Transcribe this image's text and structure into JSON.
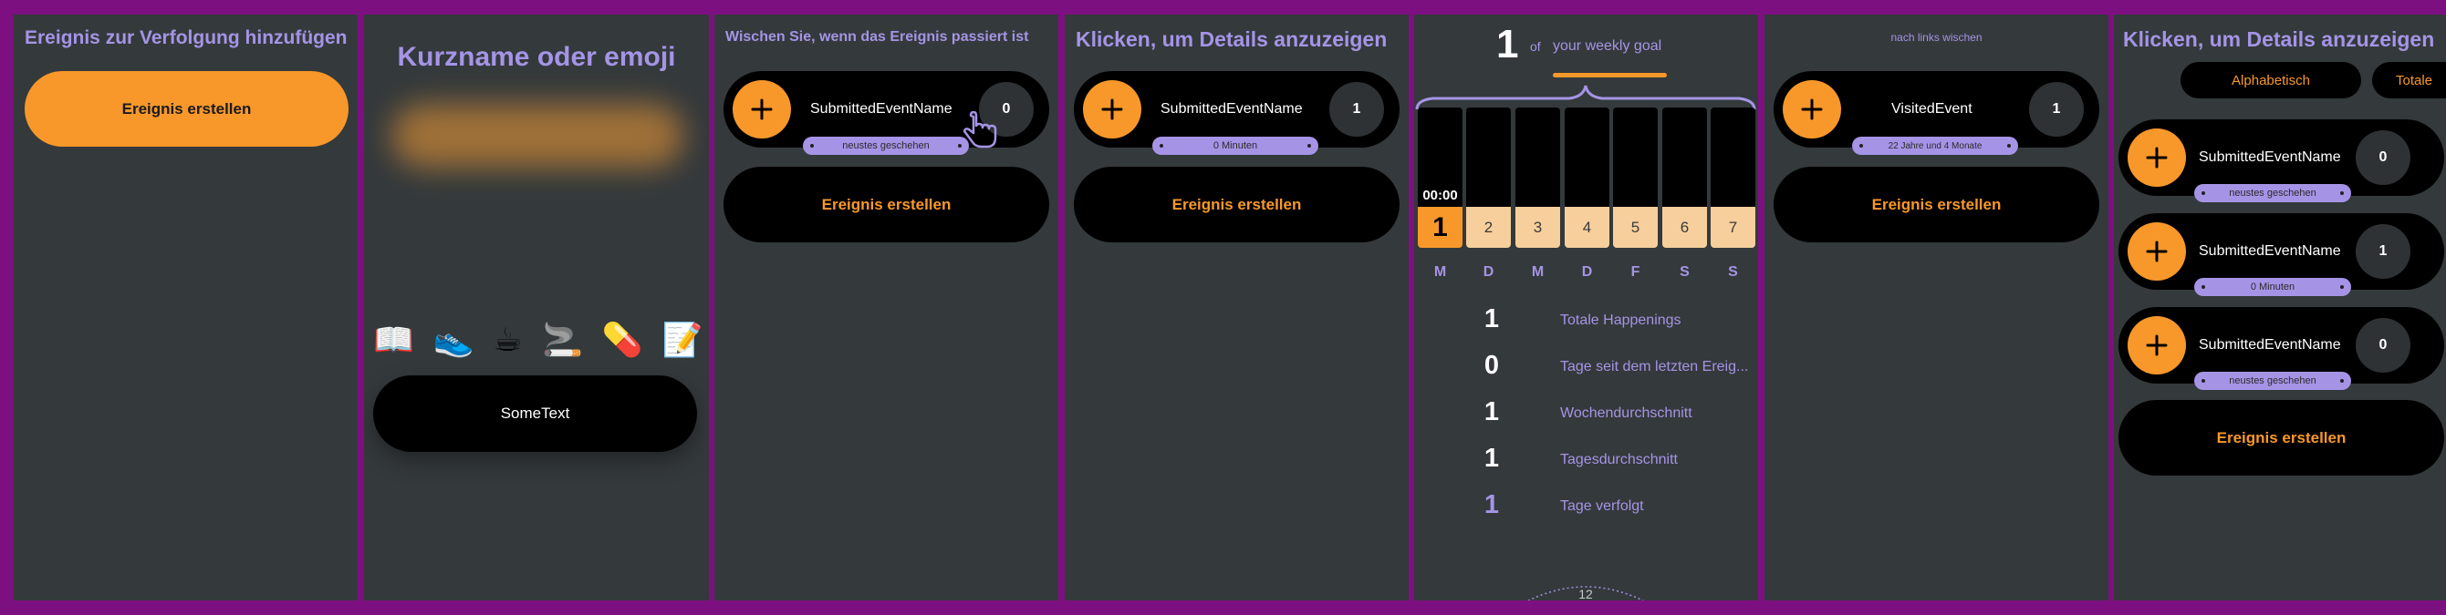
{
  "screen1": {
    "title": "Ereignis zur Verfolgung hinzufügen",
    "create_label": "Ereignis erstellen"
  },
  "screen2": {
    "title": "Kurzname oder emoji",
    "emojis": [
      "📖",
      "👟",
      "☕",
      "🚬",
      "💊",
      "📝"
    ],
    "input_value": "SomeText"
  },
  "screen3": {
    "title": "Wischen Sie, wenn das Ereignis passiert ist",
    "event_name": "SubmittedEventName",
    "count": "0",
    "sub_label": "neustes geschehen",
    "create_label": "Ereignis erstellen"
  },
  "screen4": {
    "title": "Klicken, um Details anzuzeigen",
    "event_name": "SubmittedEventName",
    "count": "1",
    "sub_label": "0 Minuten",
    "create_label": "Ereignis erstellen"
  },
  "screen5": {
    "goal_count": "1",
    "goal_of": "of",
    "goal_label": "your weekly goal",
    "bar_time": "00:00",
    "days": [
      "1",
      "2",
      "3",
      "4",
      "5",
      "6",
      "7"
    ],
    "weekdays": [
      "M",
      "D",
      "M",
      "D",
      "F",
      "S",
      "S"
    ],
    "stats": [
      {
        "value": "1",
        "label": "Totale Happenings"
      },
      {
        "value": "0",
        "label": "Tage seit dem letzten Ereig..."
      },
      {
        "value": "1",
        "label": "Wochendurchschnitt"
      },
      {
        "value": "1",
        "label": "Tagesdurchschnitt"
      },
      {
        "value": "1",
        "label": "Tage verfolgt"
      }
    ],
    "clock_number": "12"
  },
  "screen6": {
    "hint": "nach links wischen",
    "event_name": "VisitedEvent",
    "count": "1",
    "sub_label": "22 Jahre und 4 Monate",
    "create_label": "Ereignis erstellen"
  },
  "screen7": {
    "title": "Klicken, um Details anzuzeigen",
    "sort_tabs": [
      "Alphabetisch",
      "Totale"
    ],
    "events": [
      {
        "name": "SubmittedEventName",
        "count": "0",
        "sub": "neustes geschehen"
      },
      {
        "name": "SubmittedEventName",
        "count": "1",
        "sub": "0 Minuten"
      },
      {
        "name": "SubmittedEventName",
        "count": "0",
        "sub": "neustes geschehen"
      }
    ],
    "create_label": "Ereignis erstellen"
  },
  "colors": {
    "background": "#7d1080",
    "panel": "#34393b",
    "accent": "#f8982a",
    "purple": "#a594e6"
  }
}
